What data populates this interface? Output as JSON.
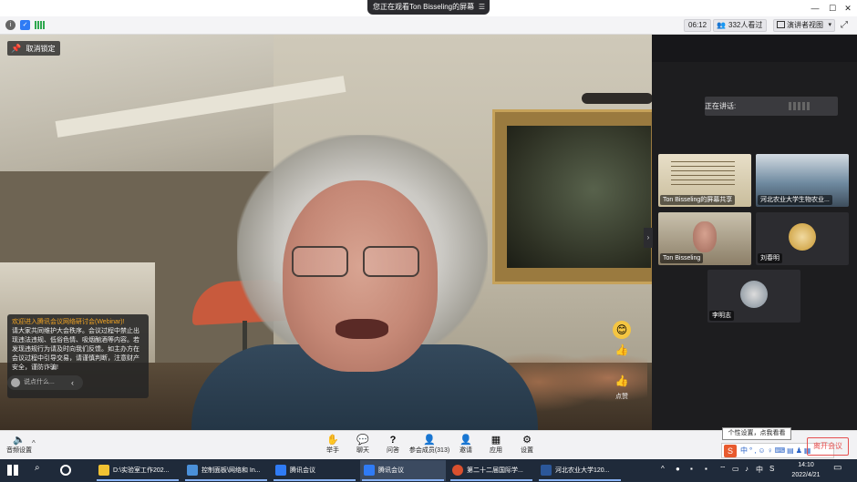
{
  "window": {
    "share_banner": "您正在观看Ton Bisseling的屏幕"
  },
  "infobar": {
    "timer": "06:12",
    "attendees": "332人看过",
    "view_mode": "演讲者视图"
  },
  "main": {
    "unpin_label": "取消锁定",
    "notice": {
      "title": "欢迎进入腾讯会议网络研讨会(Webinar)!",
      "body": "请大家共同维护大会秩序。会议过程中禁止出现违法违规、低俗色情、吸烟酗酒等内容。若发现违规行为请及时向我们反馈。如主办方在会议过程中引导交易，请谨慎判断，注意财产安全，谨防诈骗!"
    },
    "chat_placeholder": "说点什么...",
    "reaction_count": "点赞"
  },
  "right_panel": {
    "speaking_label": "正在讲话:",
    "tiles": [
      {
        "name": "Ton Bisseling的屏幕共享"
      },
      {
        "name": "河北农业大学生物农业..."
      },
      {
        "name": "Ton Bisseling"
      },
      {
        "name": "刘春明"
      },
      {
        "name": "李明志"
      }
    ]
  },
  "toolbar": {
    "audio_settings": "音频设置",
    "buttons": [
      {
        "label": "举手",
        "icon": "raise-hand-icon"
      },
      {
        "label": "聊天",
        "icon": "chat-icon"
      },
      {
        "label": "问答",
        "icon": "qa-icon"
      },
      {
        "label": "参会成员(313)",
        "icon": "members-icon"
      },
      {
        "label": "邀请",
        "icon": "invite-icon"
      },
      {
        "label": "应用",
        "icon": "apps-icon"
      },
      {
        "label": "设置",
        "icon": "settings-icon"
      }
    ],
    "end_meeting": "离开会议",
    "tooltip": "个性设置，点我看看"
  },
  "taskbar": {
    "items": [
      {
        "label": "D:\\实验室工作202...",
        "color": "#f1c232"
      },
      {
        "label": "控制面板\\网络和 In...",
        "color": "#4a90d9"
      },
      {
        "label": "腾讯会议",
        "color": "#2f7bf5"
      },
      {
        "label": "腾讯会议",
        "color": "#2f7bf5"
      },
      {
        "label": "第二十二届国际学...",
        "color": "#d9502e"
      },
      {
        "label": "河北农业大学120...",
        "color": "#2b579a"
      }
    ],
    "time": "14:10",
    "date": "2022/4/21",
    "ime_lang": "中"
  }
}
